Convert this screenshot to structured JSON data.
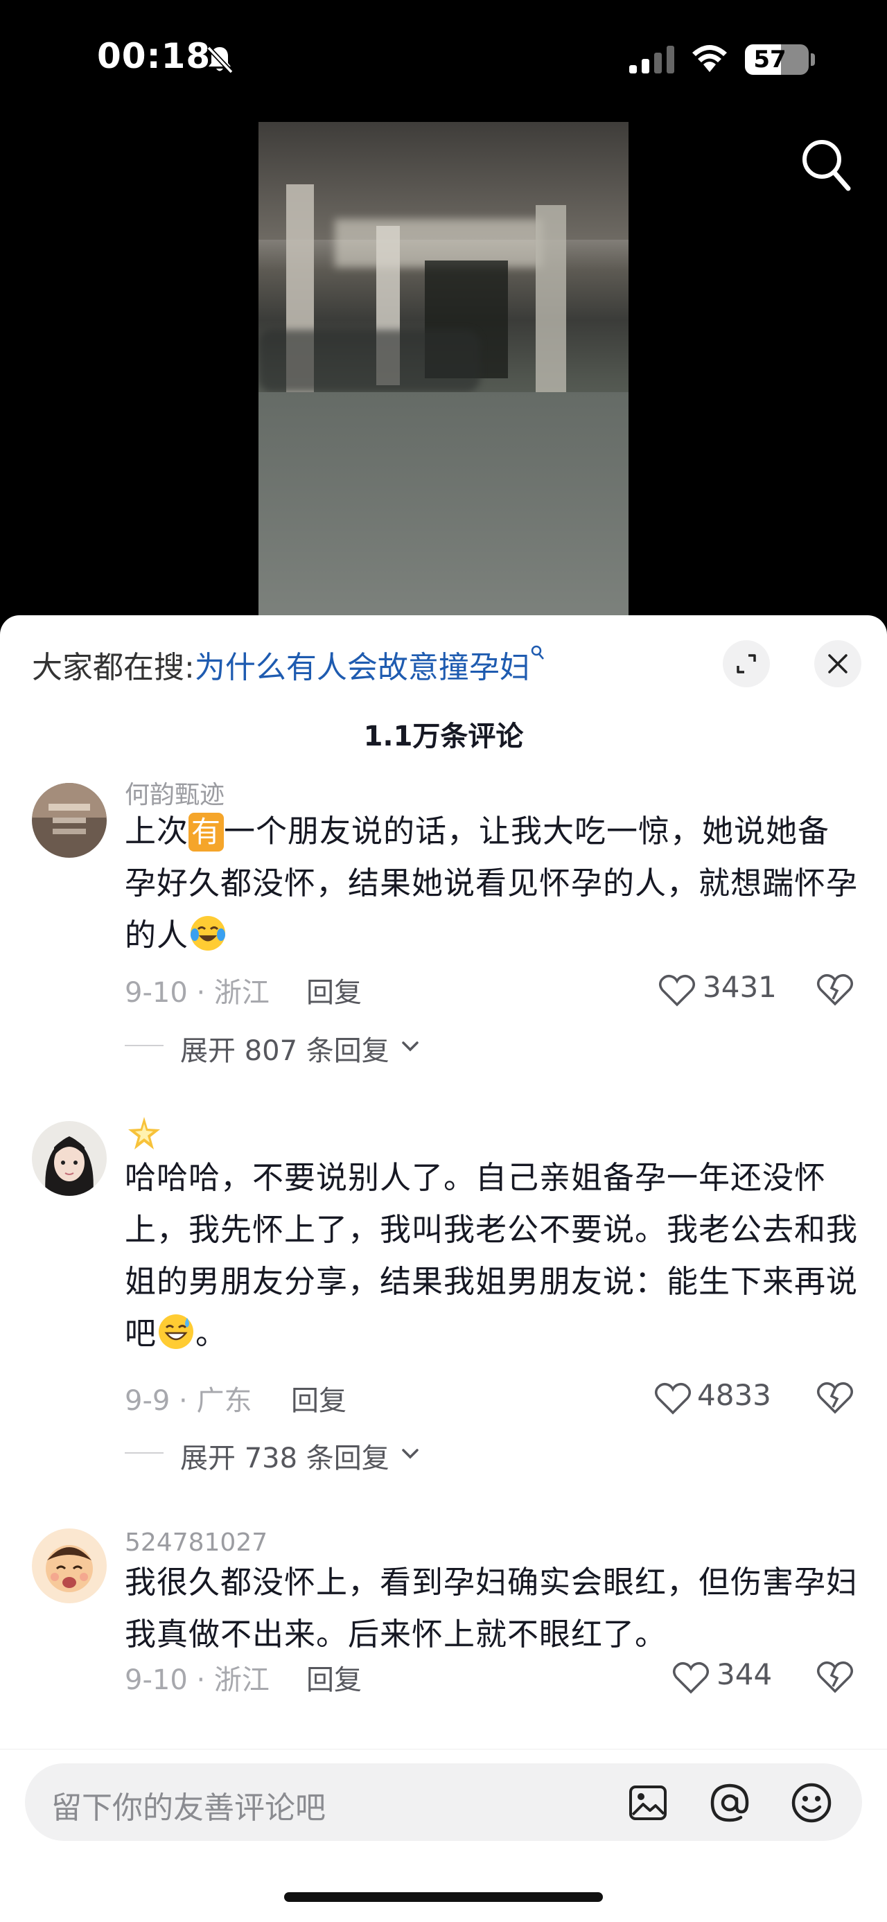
{
  "status_bar": {
    "time": "00:18",
    "battery": "57",
    "battery_level": 0.57
  },
  "icons": {
    "bell_muted": "bell-slash-icon",
    "signal": "cellular-signal-icon",
    "wifi": "wifi-icon",
    "search": "search-icon",
    "expand": "expand-icon",
    "close": "close-icon",
    "like": "heart-outline-icon",
    "dislike": "broken-heart-icon",
    "image": "image-icon",
    "mention": "at-icon",
    "emoji": "smiley-icon"
  },
  "panel": {
    "hot_search_prefix": "大家都在搜:",
    "hot_search_term": "为什么有人会故意撞孕妇",
    "comment_count": "1.1万条评论"
  },
  "comments": [
    {
      "username": "何韵甄迹",
      "text_before_tag": "上次",
      "tag": "有",
      "text_after_tag": "一个朋友说的话，让我大吃一惊，她说她备孕好久都没怀，结果她说看见怀孕的人，就想踹怀孕的人",
      "date_location": "9-10 · 浙江",
      "reply": "回复",
      "likes": "3431",
      "expand": "展开 807 条回复"
    },
    {
      "username": "",
      "text": "哈哈哈，不要说别人了。自己亲姐备孕一年还没怀上，我先怀上了，我叫我老公不要说。我老公去和我姐的男朋友分享，结果我姐男朋友说：能生下来再说吧",
      "text_end": "。",
      "date_location": "9-9 · 广东",
      "reply": "回复",
      "likes": "4833",
      "expand": "展开 738 条回复"
    },
    {
      "username": "524781027",
      "text": "我很久都没怀上，看到孕妇确实会眼红，但伤害孕妇我真做不出来。后来怀上就不眼红了。",
      "date_location": "9-10 · 浙江",
      "reply": "回复",
      "likes": "344"
    }
  ],
  "input": {
    "placeholder": "留下你的友善评论吧"
  }
}
